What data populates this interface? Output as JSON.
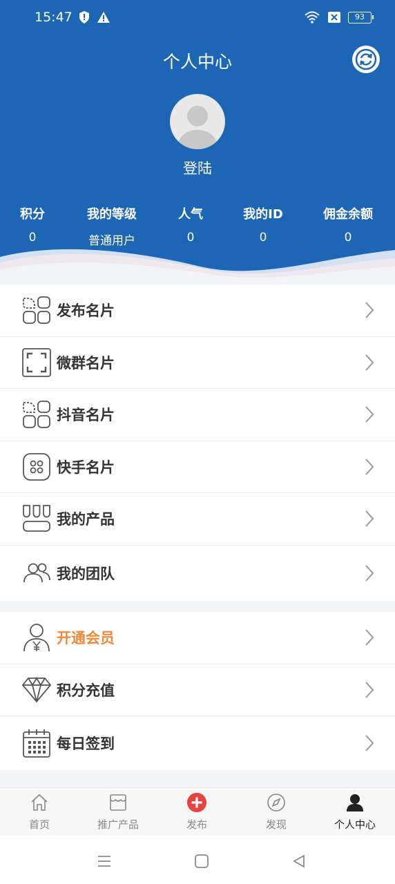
{
  "status_bar": {
    "time": "15:47",
    "battery": "93"
  },
  "header": {
    "title": "个人中心",
    "login": "登陆"
  },
  "stats": [
    {
      "label": "积分",
      "value": "0"
    },
    {
      "label": "我的等级",
      "value": "普通用户"
    },
    {
      "label": "人气",
      "value": "0"
    },
    {
      "label": "我的ID",
      "value": "0"
    },
    {
      "label": "佣金余额",
      "value": "0"
    }
  ],
  "menu_group1": [
    {
      "label": "发布名片",
      "icon": "grid-apps-icon"
    },
    {
      "label": "微群名片",
      "icon": "scan-frame-icon"
    },
    {
      "label": "抖音名片",
      "icon": "grid-apps-icon"
    },
    {
      "label": "快手名片",
      "icon": "dots-square-icon"
    },
    {
      "label": "我的产品",
      "icon": "product-columns-icon"
    },
    {
      "label": "我的团队",
      "icon": "team-icon"
    }
  ],
  "menu_group2": [
    {
      "label": "开通会员",
      "icon": "vip-user-icon",
      "color": "#f0883a"
    },
    {
      "label": "积分充值",
      "icon": "diamond-icon"
    },
    {
      "label": "每日签到",
      "icon": "calendar-icon"
    }
  ],
  "tabs": [
    {
      "label": "首页",
      "icon": "home-icon"
    },
    {
      "label": "推广产品",
      "icon": "store-icon"
    },
    {
      "label": "发布",
      "icon": "plus-circle-icon"
    },
    {
      "label": "发现",
      "icon": "compass-icon"
    },
    {
      "label": "个人中心",
      "icon": "user-icon",
      "active": true
    }
  ],
  "colors": {
    "header_blue": "#1d66b6",
    "accent_orange": "#f0883a",
    "publish_red": "#e64340"
  }
}
